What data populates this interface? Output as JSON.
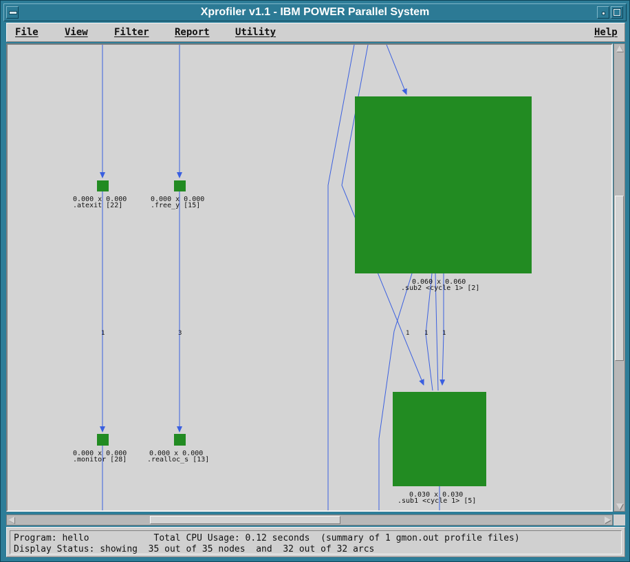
{
  "window": {
    "title": "Xprofiler v1.1 - IBM POWER Parallel System"
  },
  "menubar": {
    "items": [
      {
        "label": "File"
      },
      {
        "label": "View"
      },
      {
        "label": "Filter"
      },
      {
        "label": "Report"
      },
      {
        "label": "Utility"
      },
      {
        "label": "Help"
      }
    ]
  },
  "graph": {
    "nodes": [
      {
        "id": "atexit",
        "times": "0.000 x 0.000",
        "name": ".atexit [22]"
      },
      {
        "id": "free_y",
        "times": "0.000 x 0.000",
        "name": ".free_y [15]"
      },
      {
        "id": "monitor",
        "times": "0.000 x 0.000",
        "name": ".monitor [28]"
      },
      {
        "id": "realloc_s",
        "times": "0.000 x 0.000",
        "name": ".realloc_s [13]"
      },
      {
        "id": "sub2",
        "times": "0.060 x 0.060",
        "name": ".sub2 <cycle 1> [2]"
      },
      {
        "id": "sub1",
        "times": "0.030 x 0.030",
        "name": ".sub1 <cycle 1> [5]"
      }
    ],
    "edge_labels": [
      "1",
      "3",
      "1",
      "1",
      "1"
    ],
    "colors": {
      "node": "#228b22",
      "edge": "#3a5fe0",
      "background": "#d4d4d4"
    }
  },
  "status": {
    "line1": "Program: hello            Total CPU Usage: 0.12 seconds  (summary of 1 gmon.out profile files)",
    "line2": "Display Status: showing  35 out of 35 nodes  and  32 out of 32 arcs"
  },
  "icons": {
    "system_menu": "window-menu-icon",
    "minimize": "minimize-icon",
    "maximize": "maximize-icon"
  }
}
